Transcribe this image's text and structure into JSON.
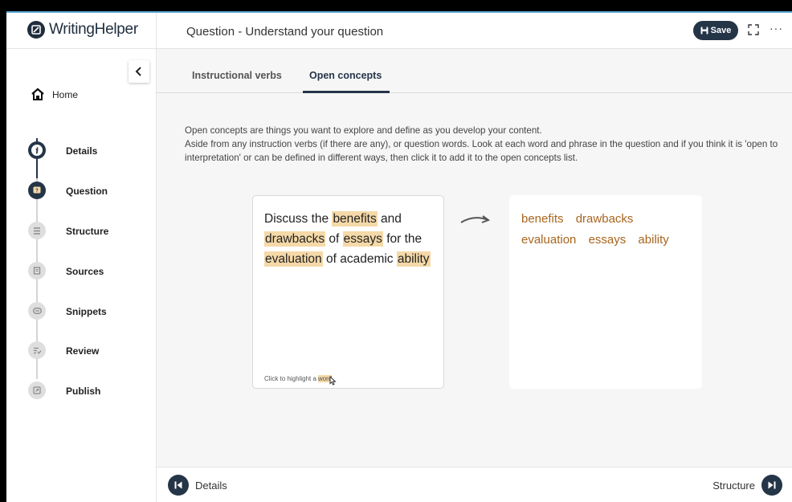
{
  "app": {
    "name": "WritingHelper"
  },
  "header": {
    "title": "Question - Understand your question",
    "save_label": "Save",
    "expand_icon": "expand-icon",
    "more_label": "···"
  },
  "sidebar": {
    "collapse_label": "<",
    "home_label": "Home",
    "items": [
      {
        "label": "Details",
        "icon": "info-icon",
        "state": "done"
      },
      {
        "label": "Question",
        "icon": "question-icon",
        "state": "active"
      },
      {
        "label": "Structure",
        "icon": "list-icon",
        "state": "todo"
      },
      {
        "label": "Sources",
        "icon": "book-icon",
        "state": "todo"
      },
      {
        "label": "Snippets",
        "icon": "clip-icon",
        "state": "todo"
      },
      {
        "label": "Review",
        "icon": "review-icon",
        "state": "todo"
      },
      {
        "label": "Publish",
        "icon": "publish-icon",
        "state": "todo"
      }
    ]
  },
  "tabs": [
    {
      "label": "Instructional verbs",
      "active": false
    },
    {
      "label": "Open concepts",
      "active": true
    }
  ],
  "intro": {
    "line1": "Open concepts are things you want to explore and define as you develop your content.",
    "line2": "Aside from any instruction verbs (if there are any), or question words. Look at each word and phrase in the question and if you think it is 'open to interpretation' or can be defined in different ways, then click it to add it to the open concepts list."
  },
  "question": {
    "w1": "Discuss the",
    "h1": "benefits",
    "w2": "and",
    "h2": "drawbacks",
    "w3": "of",
    "h3": "essays",
    "w4": "for the",
    "h4": "evaluation",
    "w5": "of academic",
    "h5": "ability",
    "hint_prefix": "Click to highlight a",
    "hint_word": "word"
  },
  "concepts": [
    "benefits",
    "drawbacks",
    "evaluation",
    "essays",
    "ability"
  ],
  "footer": {
    "prev_label": "Details",
    "next_label": "Structure"
  },
  "colors": {
    "primary": "#253548",
    "highlight": "#f5d9a8",
    "concept_text": "#a8651e",
    "accent_line": "#5ea9d6"
  }
}
